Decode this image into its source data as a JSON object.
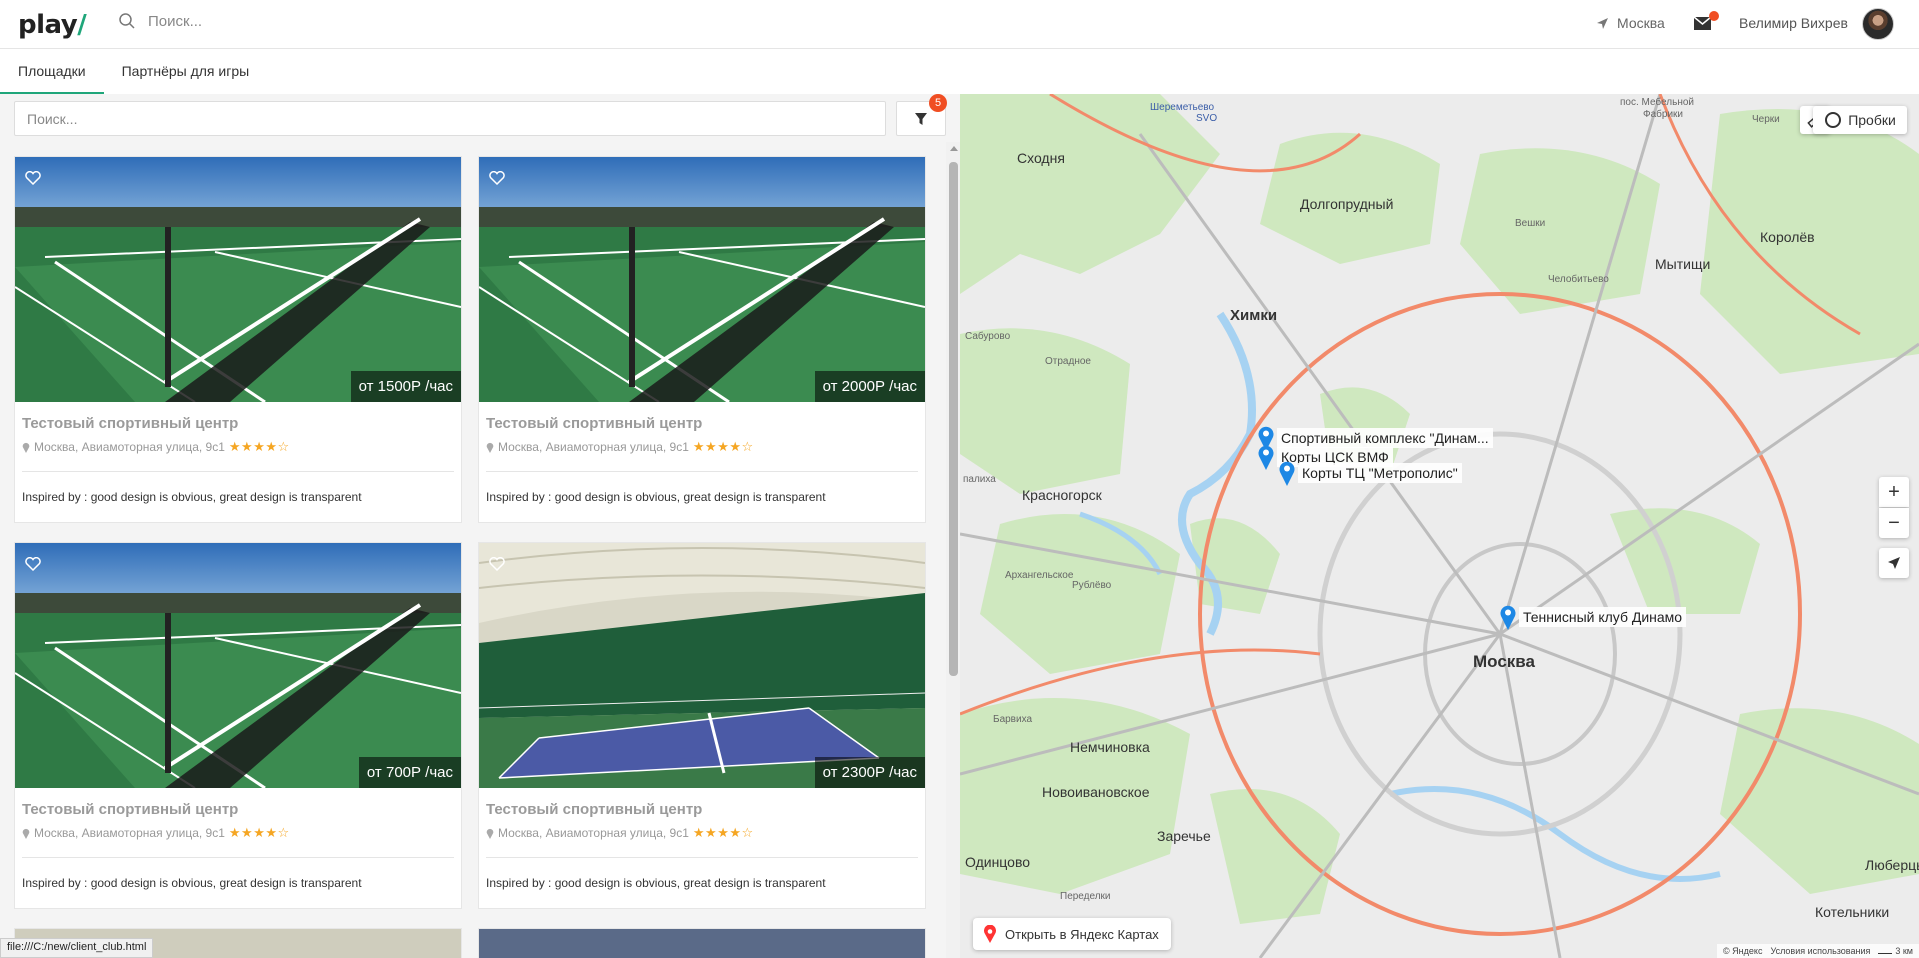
{
  "header": {
    "logo_text": "play",
    "logo_slash": "/",
    "search_placeholder": "Поиск...",
    "city": "Москва",
    "user_name": "Велимир Вихрев"
  },
  "tabs": [
    {
      "label": "Площадки",
      "active": true
    },
    {
      "label": "Партнёры для игры",
      "active": false
    }
  ],
  "filter": {
    "search_placeholder": "Поиск...",
    "badge_count": "5"
  },
  "cards": [
    {
      "title": "Тестовый спортивный центр",
      "address": "Москва, Авиамоторная улица, 9с1",
      "price": "от 1500Р /час",
      "rating": 4,
      "description": "Inspired by : good design is obvious, great design is transparent",
      "image": "outdoor-court"
    },
    {
      "title": "Тестовый спортивный центр",
      "address": "Москва, Авиамоторная улица, 9с1",
      "price": "от 2000Р /час",
      "rating": 4,
      "description": "Inspired by : good design is obvious, great design is transparent",
      "image": "outdoor-court"
    },
    {
      "title": "Тестовый спортивный центр",
      "address": "Москва, Авиамоторная улица, 9с1",
      "price": "от 700Р /час",
      "rating": 4,
      "description": "Inspired by : good design is obvious, great design is transparent",
      "image": "outdoor-court"
    },
    {
      "title": "Тестовый спортивный центр",
      "address": "Москва, Авиамоторная улица, 9с1",
      "price": "от 2300Р /час",
      "rating": 4,
      "description": "Inspired by : good design is obvious, great design is transparent",
      "image": "indoor-court"
    }
  ],
  "map": {
    "traffic_label": "Пробки",
    "zoom_in": "+",
    "zoom_out": "−",
    "open_in_yandex": "Открыть в Яндекс Картах",
    "copyright_brand": "© Яндекс",
    "terms": "Условия использования",
    "scale": "3 км",
    "markers": [
      {
        "label": "Спортивный комплекс \"Динам..."
      },
      {
        "label": "Корты ЦСК ВМФ"
      },
      {
        "label": "Корты ТЦ \"Метрополис\""
      },
      {
        "label": "Теннисный клуб Динамо"
      }
    ],
    "places": {
      "moskva": "Москва",
      "himki": "Химки",
      "dolgoprudny": "Долгопрудный",
      "mytishchi": "Мытищи",
      "korolev": "Королёв",
      "krasnogorsk": "Красногорск",
      "skhodnya": "Сходня",
      "nemchinovka": "Немчиновка",
      "novoivanovskoe": "Новоивановское",
      "odintsovo": "Одинцово",
      "zarechye": "Заречье",
      "lubertsy": "Люберцы",
      "kotelniki": "Котельники",
      "vnukovo_road": "Переделки",
      "sabur": "Сабурово",
      "otradnoe": "Отрадное",
      "arkhangelskoe": "Архангельское",
      "rublevo": "Рублёво",
      "barvikha": "Барвиха",
      "vostochny": "Вешки",
      "chelobityevo": "Челобитьево",
      "sheremetyevo": "Шереметьево",
      "svo": "SVO",
      "mebelnaya": "пос. Мебельной",
      "fabriki": "Фабрики",
      "cherkiz": "Черки",
      "palikha": "палиха"
    }
  },
  "status_url": "file:///C:/new/client_club.html"
}
